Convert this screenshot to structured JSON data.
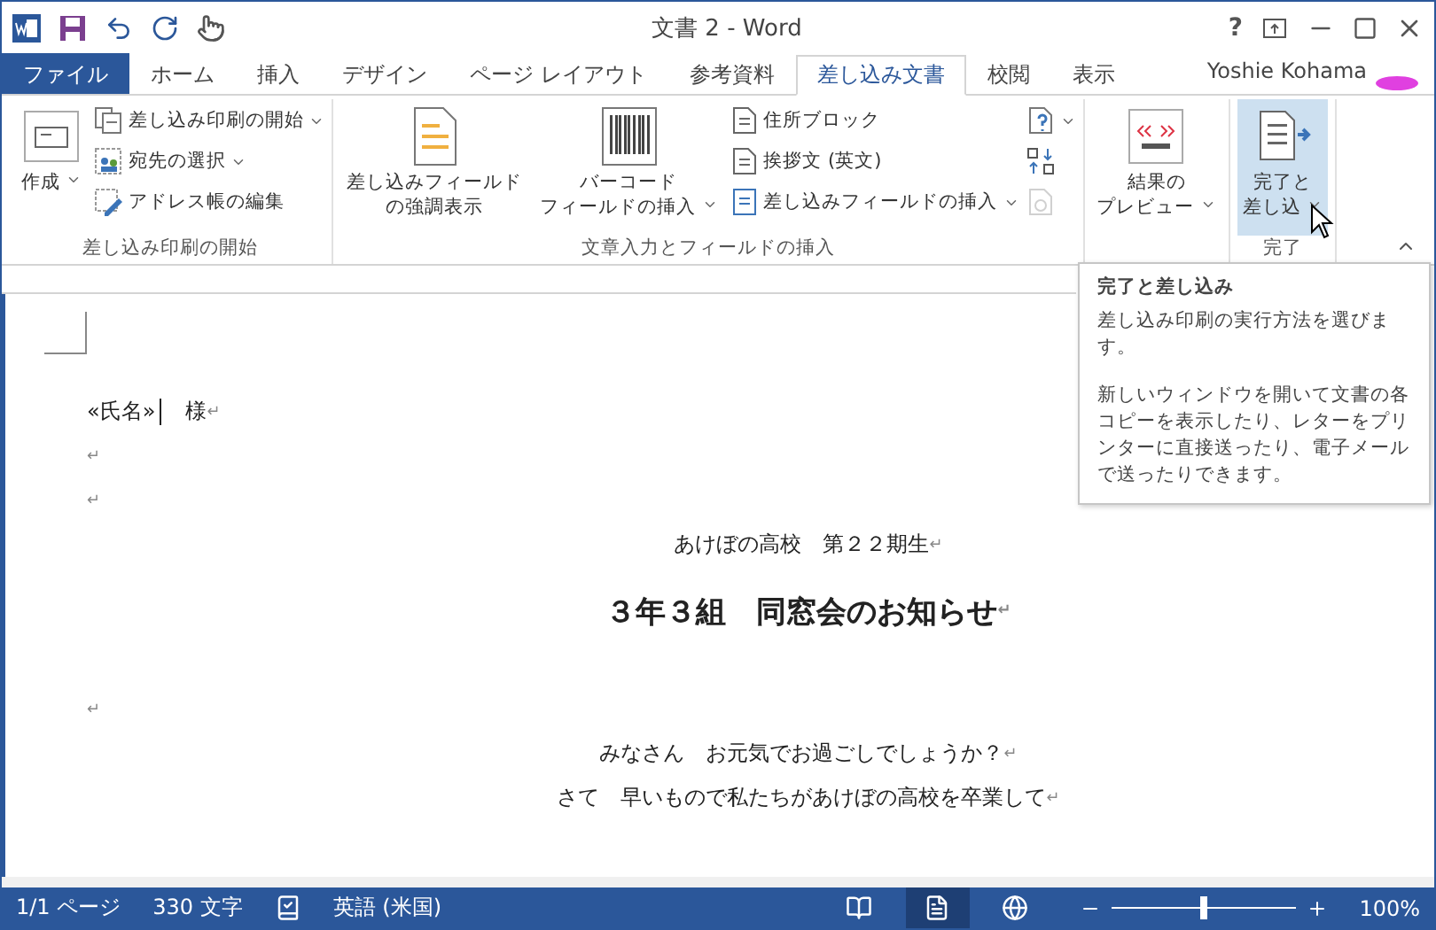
{
  "window": {
    "title": "文書 2 - Word",
    "help": "?"
  },
  "tabs": [
    {
      "label": "ファイル",
      "kind": "file",
      "selected": false
    },
    {
      "label": "ホーム",
      "kind": "tab",
      "selected": false
    },
    {
      "label": "挿入",
      "kind": "tab",
      "selected": false
    },
    {
      "label": "デザイン",
      "kind": "tab",
      "selected": false
    },
    {
      "label": "ページ レイアウト",
      "kind": "tab",
      "selected": false
    },
    {
      "label": "参考資料",
      "kind": "tab",
      "selected": false
    },
    {
      "label": "差し込み文書",
      "kind": "tab",
      "selected": true
    },
    {
      "label": "校閲",
      "kind": "tab",
      "selected": false
    },
    {
      "label": "表示",
      "kind": "tab",
      "selected": false
    }
  ],
  "user": {
    "name": "Yoshie Kohama"
  },
  "ribbon": {
    "groups": [
      {
        "label": "差し込み印刷の開始",
        "columns": [
          {
            "kind": "large",
            "lines": [
              "作成"
            ],
            "dropdown": true,
            "highlighted": false
          },
          {
            "kind": "stack",
            "items": [
              {
                "label": "差し込み印刷の開始",
                "dropdown": true,
                "disabled": false
              },
              {
                "label": "宛先の選択",
                "dropdown": true,
                "disabled": false
              },
              {
                "label": "アドレス帳の編集",
                "dropdown": false,
                "disabled": false
              }
            ]
          }
        ]
      },
      {
        "label": "文章入力とフィールドの挿入",
        "columns": [
          {
            "kind": "large",
            "lines": [
              "差し込みフィールド",
              "の強調表示"
            ],
            "dropdown": false,
            "highlighted": false
          },
          {
            "kind": "large",
            "lines": [
              "バーコード",
              "フィールドの挿入"
            ],
            "dropdown": true,
            "highlighted": false
          },
          {
            "kind": "stack",
            "items": [
              {
                "label": "住所ブロック",
                "dropdown": false,
                "disabled": false
              },
              {
                "label": "挨拶文 (英文)",
                "dropdown": false,
                "disabled": false
              },
              {
                "label": "差し込みフィールドの挿入",
                "dropdown": true,
                "disabled": false
              }
            ]
          },
          {
            "kind": "stack",
            "items": [
              {
                "dropdown": true,
                "disabled": false
              },
              {
                "dropdown": false,
                "disabled": false
              },
              {
                "dropdown": false,
                "disabled": true
              }
            ]
          }
        ]
      },
      {
        "columns": [
          {
            "kind": "large",
            "lines": [
              "結果の",
              "プレビュー"
            ],
            "dropdown": true,
            "highlighted": false
          }
        ]
      },
      {
        "label": "完了",
        "columns": [
          {
            "kind": "large",
            "lines": [
              "完了と",
              "差し込"
            ],
            "dropdown": true,
            "highlighted": true
          }
        ]
      }
    ]
  },
  "tooltip": {
    "title": "完了と差し込み",
    "paragraphs": [
      "差し込み印刷の実行方法を選びます。",
      "新しいウィンドウを開いて文書の各コピーを表示したり、レターをプリンターに直接送ったり、電子メールで送ったりできます。"
    ]
  },
  "document": {
    "paragraphs": [
      {
        "kind": "field",
        "field": "«氏名»",
        "text": "　様",
        "cursor": true,
        "mark": "↵"
      },
      {
        "kind": "empty",
        "mark": "↵"
      },
      {
        "kind": "empty",
        "mark": "↵"
      },
      {
        "kind": "body",
        "text": "あけぼの高校　第２２期生",
        "mark": "↵"
      },
      {
        "kind": "heading",
        "text": "３年３組　同窓会のお知らせ",
        "mark": "↵"
      },
      {
        "kind": "empty",
        "mark": "↵"
      },
      {
        "kind": "body",
        "text": "みなさん　お元気でお過ごしでしょうか？",
        "mark": "↵"
      },
      {
        "kind": "body",
        "text": "さて　早いもので私たちがあけぼの高校を卒業して",
        "mark": "↵"
      }
    ]
  },
  "status_bar": {
    "page": "1/1 ページ",
    "words": "330 文字",
    "language": "英語 (米国)",
    "views": [
      {
        "kind": "read",
        "selected": false
      },
      {
        "kind": "print",
        "selected": true
      },
      {
        "kind": "web",
        "selected": false
      }
    ],
    "zoom": {
      "level": 0.5,
      "reading": "100%"
    }
  }
}
